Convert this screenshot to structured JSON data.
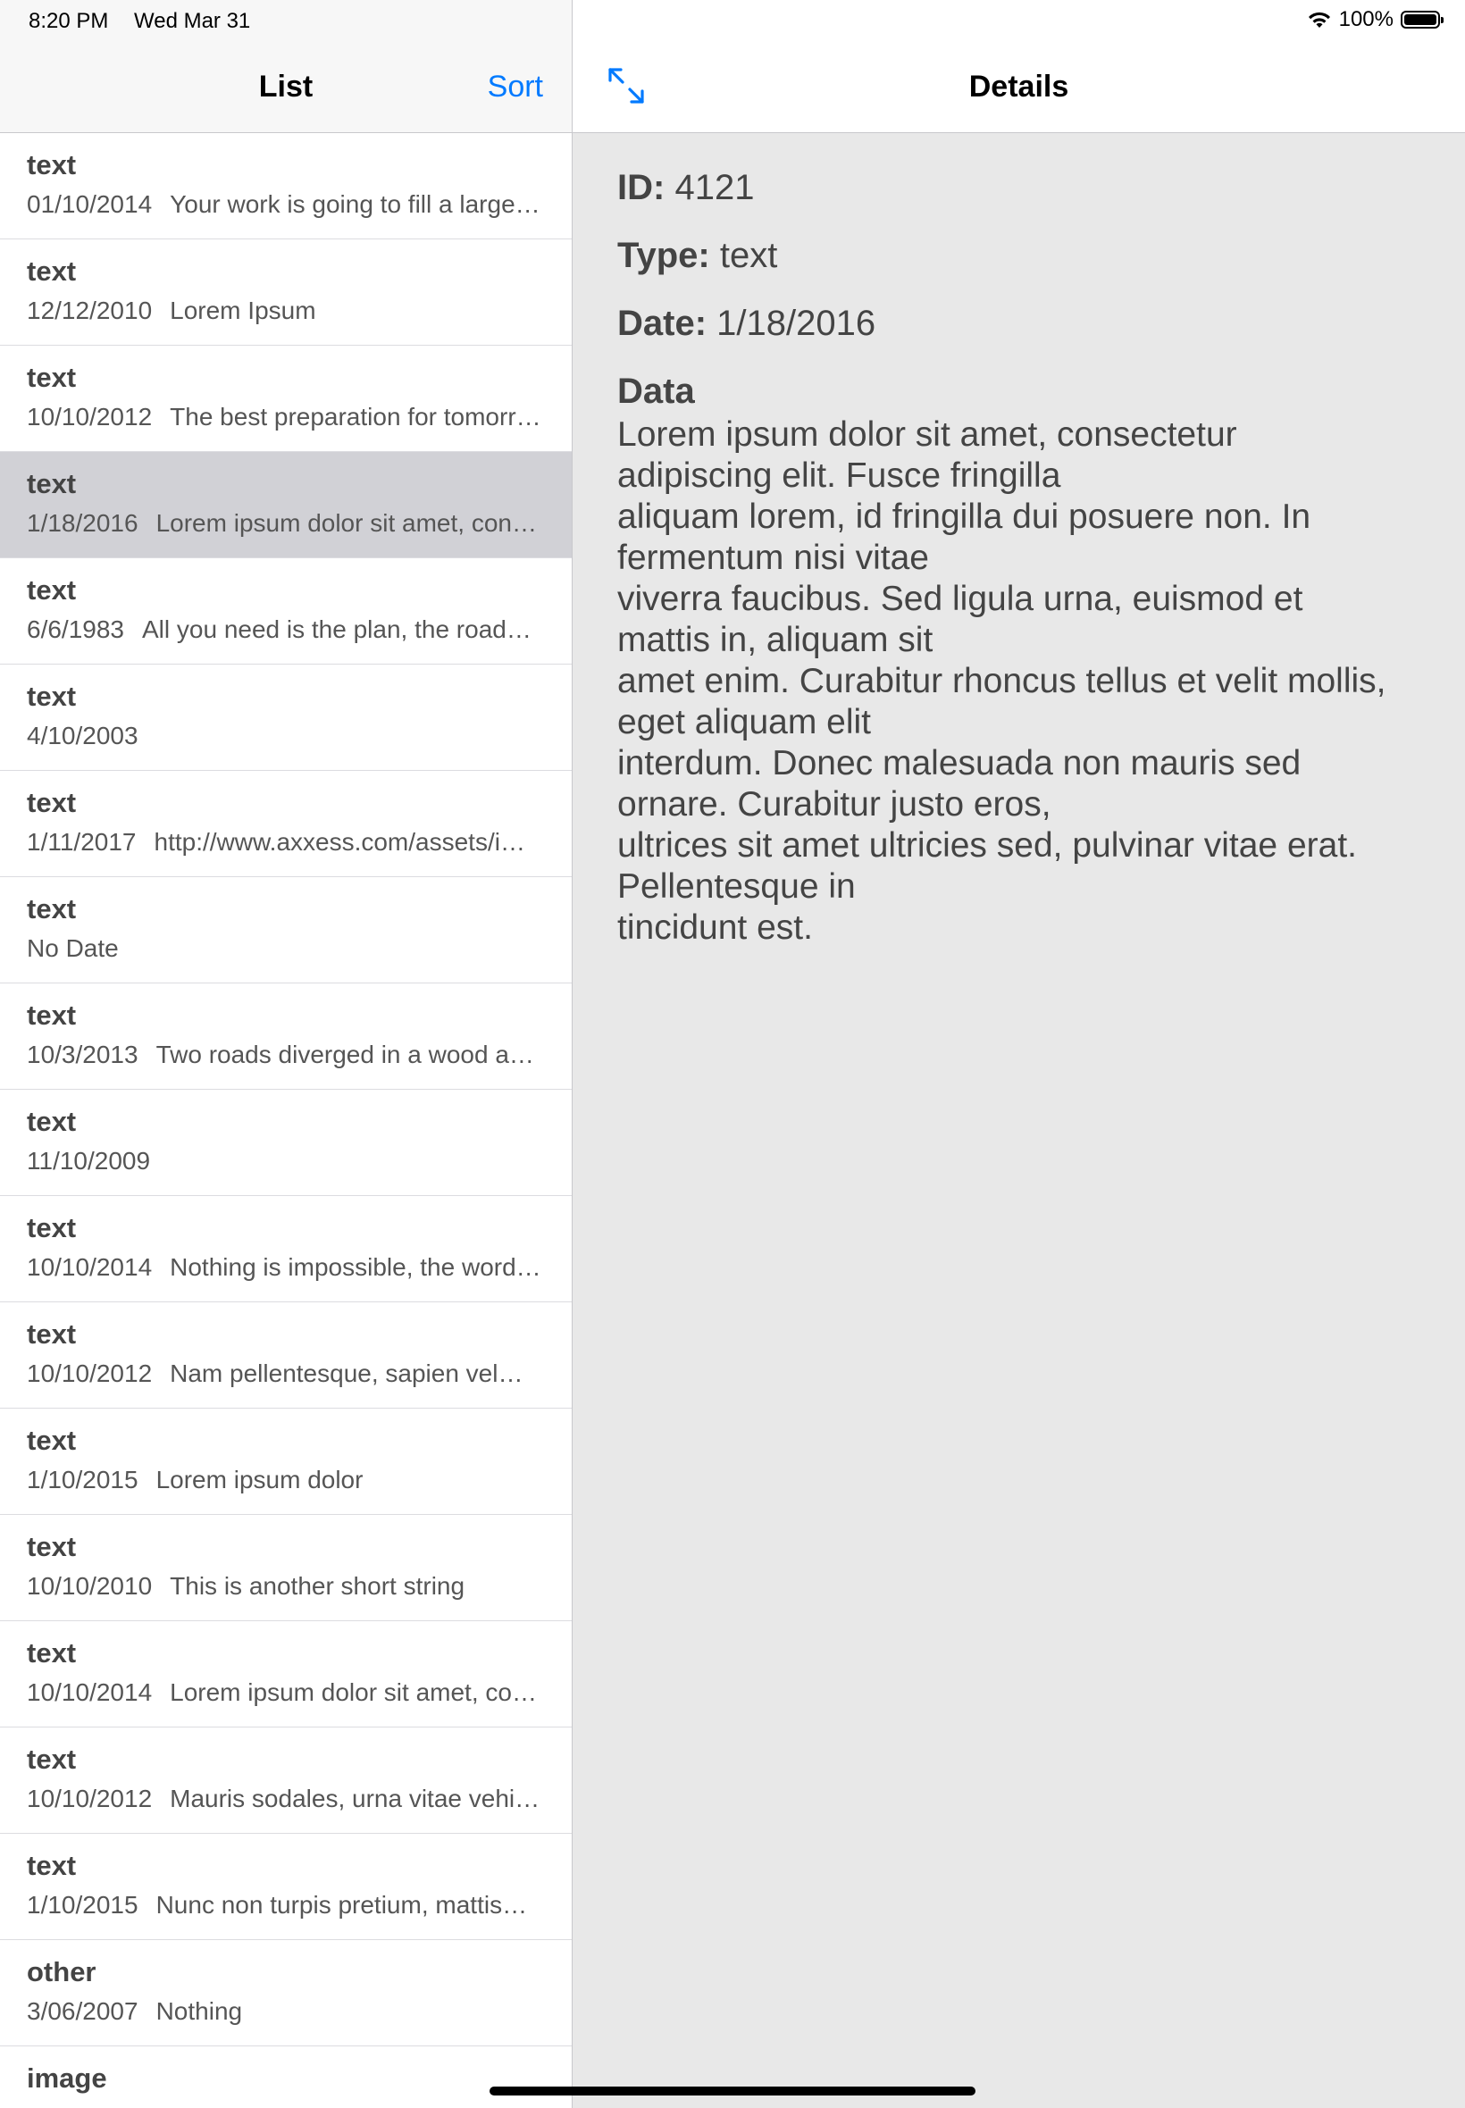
{
  "status_bar": {
    "time": "8:20 PM",
    "date": "Wed Mar 31",
    "battery": "100%"
  },
  "list_pane": {
    "title": "List",
    "sort_label": "Sort",
    "items": [
      {
        "type": "text",
        "date": "01/10/2014",
        "preview": "Your work is going to fill a large…"
      },
      {
        "type": "text",
        "date": "12/12/2010",
        "preview": "Lorem Ipsum"
      },
      {
        "type": "text",
        "date": "10/10/2012",
        "preview": "The best preparation for tomorr…"
      },
      {
        "type": "text",
        "date": "1/18/2016",
        "preview": "Lorem ipsum dolor sit amet, con…",
        "selected": true
      },
      {
        "type": "text",
        "date": "6/6/1983",
        "preview": "All you need is the plan, the road…"
      },
      {
        "type": "text",
        "date": "4/10/2003",
        "preview": ""
      },
      {
        "type": "text",
        "date": "1/11/2017",
        "preview": "http://www.axxess.com/assets/i…"
      },
      {
        "type": "text",
        "date": "No Date",
        "preview": ""
      },
      {
        "type": "text",
        "date": "10/3/2013",
        "preview": "Two roads diverged in a wood a…"
      },
      {
        "type": "text",
        "date": "11/10/2009",
        "preview": ""
      },
      {
        "type": "text",
        "date": "10/10/2014",
        "preview": "Nothing is impossible, the word…"
      },
      {
        "type": "text",
        "date": "10/10/2012",
        "preview": "Nam pellentesque, sapien vel…"
      },
      {
        "type": "text",
        "date": "1/10/2015",
        "preview": "Lorem ipsum dolor"
      },
      {
        "type": "text",
        "date": "10/10/2010",
        "preview": "This is another short string"
      },
      {
        "type": "text",
        "date": "10/10/2014",
        "preview": "Lorem ipsum dolor sit amet, co…"
      },
      {
        "type": "text",
        "date": "10/10/2012",
        "preview": "Mauris sodales, urna vitae vehi…"
      },
      {
        "type": "text",
        "date": "1/10/2015",
        "preview": "Nunc non turpis pretium, mattis…"
      },
      {
        "type": "other",
        "date": "3/06/2007",
        "preview": "Nothing"
      },
      {
        "type": "image",
        "date": "",
        "preview": ""
      }
    ]
  },
  "detail_pane": {
    "title": "Details",
    "expand_icon": "expand-arrows-icon",
    "id_label": "ID:",
    "id_value": "4121",
    "type_label": "Type:",
    "type_value": "text",
    "date_label": "Date:",
    "date_value": "1/18/2016",
    "data_heading": "Data",
    "data_body": "Lorem ipsum dolor sit amet, consectetur\nadipiscing elit. Fusce fringilla\n aliquam lorem, id fringilla dui posuere non. In\nfermentum nisi vitae\nviverra faucibus. Sed ligula urna, euismod et\nmattis in, aliquam sit\namet enim. Curabitur rhoncus tellus et velit mollis,\neget aliquam elit\ninterdum. Donec malesuada non mauris sed\nornare. Curabitur justo eros,\nultrices sit amet ultricies sed, pulvinar vitae erat.\nPellentesque in\ntincidunt est."
  },
  "colors": {
    "accent": "#007aff",
    "selected_row": "#d1d1d6",
    "detail_background": "#e8e8e8"
  }
}
